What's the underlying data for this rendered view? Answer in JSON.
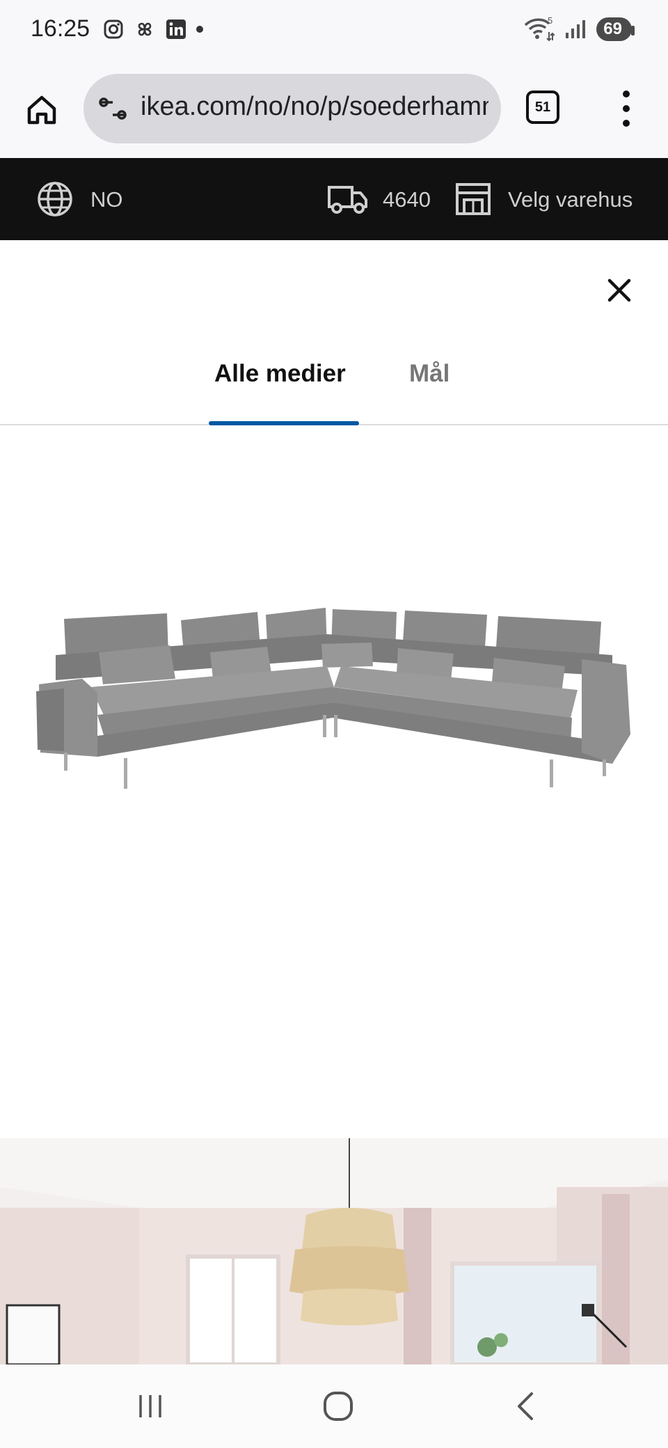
{
  "status_bar": {
    "time": "16:25",
    "notification_icons": [
      "instagram-icon",
      "pinwheel-icon",
      "linkedin-icon"
    ],
    "battery": "69",
    "wifi_label": "5"
  },
  "browser": {
    "url": "ikea.com/no/no/p/soederhamn",
    "tab_count": "51"
  },
  "ikea_bar": {
    "country": "NO",
    "postcode": "4640",
    "store_label": "Velg varehus"
  },
  "modal": {
    "tabs": [
      {
        "label": "Alle medier",
        "active": true
      },
      {
        "label": "Mål",
        "active": false
      }
    ]
  },
  "colors": {
    "accent": "#0058a3",
    "sofa": "#8c8c8c",
    "dark_bar": "#111111"
  }
}
